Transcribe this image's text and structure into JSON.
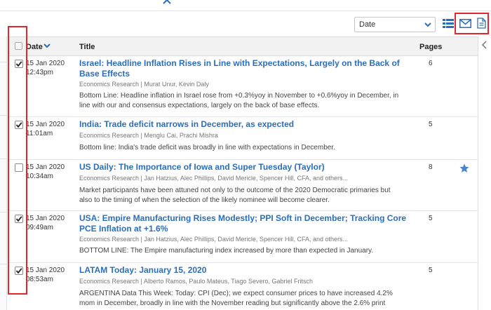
{
  "toolbar": {
    "sort_value": "Date",
    "icons": [
      "collapse-up-icon",
      "chevron-down-icon",
      "list-view-icon",
      "email-icon",
      "document-icon"
    ]
  },
  "table": {
    "headers": {
      "date": "Date",
      "title": "Title",
      "pages": "Pages"
    },
    "rows": [
      {
        "checked": true,
        "date": "15 Jan 2020",
        "time": "12:43pm",
        "title": "Israel: Headline Inflation Rises in Line with Expectations, Largely on the Back of Base Effects",
        "meta": "Economics Research | Murat Unur, Kevin Daly",
        "summary": "Bottom Line: Headline inflation in Israel rose from +0.3%yoy in November to +0.6%yoy in December, in line with our and consensus expectations, largely on the back of base effects.",
        "pages": "6",
        "starred": false
      },
      {
        "checked": true,
        "date": "15 Jan 2020",
        "time": "11:01am",
        "title": "India: Trade deficit narrows in December, as expected",
        "meta": "Economics Research | Menglu Cai, Prachi Mishra",
        "summary": "Bottom line: India's trade deficit was broadly in line with expectations in December.",
        "pages": "5",
        "starred": false
      },
      {
        "checked": false,
        "date": "15 Jan 2020",
        "time": "10:34am",
        "title": "US Daily: The Importance of Iowa and Super Tuesday (Taylor)",
        "meta": "Economics Research | Jan Hatzius, Alec Phillips, David Mericle, Spencer Hill, CFA, and others...",
        "summary": "Market participants have been attuned not only to the outcome of the 2020 Democratic primaries but also to the timing of when the selection of the likely nominee will become clearer.",
        "pages": "8",
        "starred": true
      },
      {
        "checked": true,
        "date": "15 Jan 2020",
        "time": "09:49am",
        "title": "USA: Empire Manufacturing Rises Modestly; PPI Soft in December; Tracking Core PCE Inflation at +1.6%",
        "meta": "Economics Research | Jan Hatzius, Alec Phillips, David Mericle, Spencer Hill, CFA, and others...",
        "summary": "BOTTOM LINE: The Empire manufacturing index increased by more than expected in January.",
        "pages": "5",
        "starred": false
      },
      {
        "checked": true,
        "date": "15 Jan 2020",
        "time": "08:53am",
        "title": "LATAM Today: January 15, 2020",
        "meta": "Economics Research | Alberto Ramos, Paulo Mateus, Tiago Severo, Gabriel Fritsch",
        "summary": "ARGENTINA Data This Week: Today: CPI (Dec); we expect consumer prices to have increased 4.2% mom in December, broadly in line with the November reading but significantly above the 2.6% print",
        "pages": "5",
        "starred": false
      }
    ]
  },
  "colors": {
    "accent": "#2a6ebb",
    "highlight": "#e3262f",
    "header_bg": "#f2f2f2"
  }
}
